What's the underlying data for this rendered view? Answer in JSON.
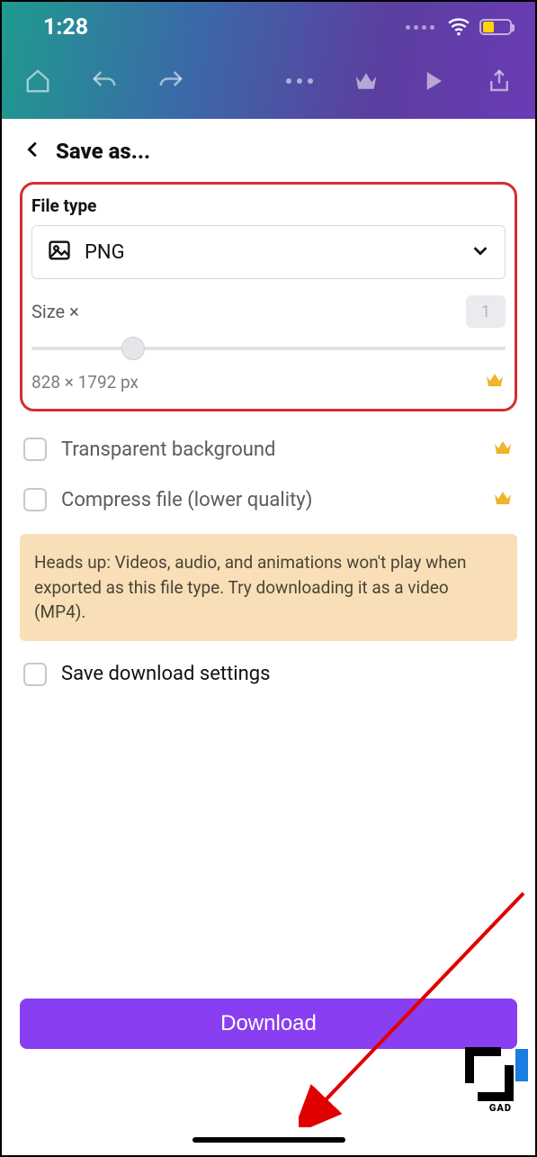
{
  "status": {
    "time": "1:28"
  },
  "sheet": {
    "title": "Save as..."
  },
  "fileType": {
    "label": "File type",
    "selected": "PNG"
  },
  "size": {
    "label": "Size ×",
    "multiplier": "1",
    "dimensions": "828 × 1792 px"
  },
  "options": {
    "transparent": "Transparent background",
    "compress": "Compress file (lower quality)",
    "saveSettings": "Save download settings"
  },
  "notice": "Heads up: Videos, audio, and animations won't play when exported as this file type. Try downloading it as a video (MP4).",
  "download": "Download",
  "watermark": "GAD"
}
